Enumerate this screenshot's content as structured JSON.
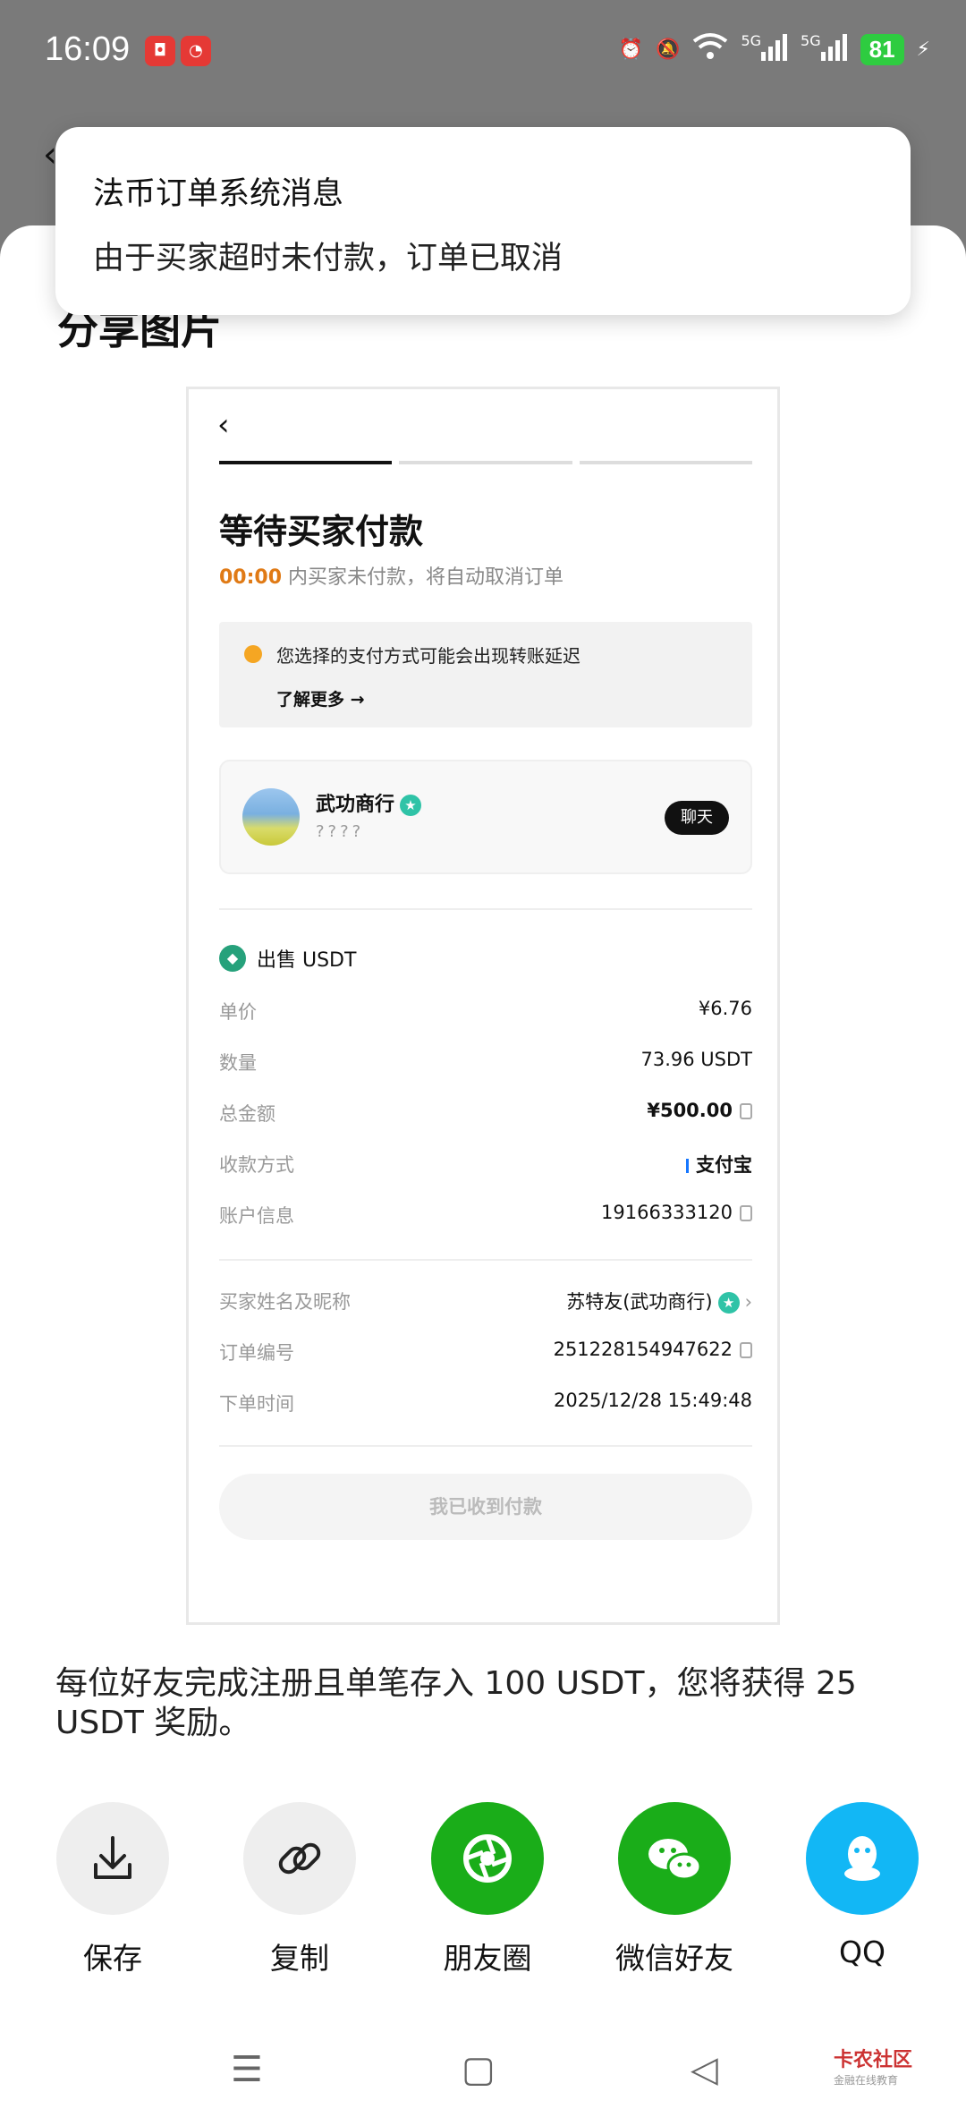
{
  "status_bar": {
    "time": "16:09",
    "battery": "81",
    "network_1": "5G",
    "network_2": "5G"
  },
  "toast": {
    "title": "法币订单系统消息",
    "body": "由于买家超时未付款，订单已取消"
  },
  "sheet": {
    "title": "分享图片"
  },
  "preview": {
    "heading": "等待买家付款",
    "timer": "00:00",
    "timer_suffix": "内买家未付款，将自动取消订单",
    "notice": "您选择的支付方式可能会出现转账延迟",
    "learn_more": "了解更多 →",
    "merchant": {
      "name": "武功商行",
      "nickname": "????",
      "chat": "聊天"
    },
    "sell_label": "出售 USDT",
    "rows": [
      {
        "key": "单价",
        "value": "¥6.76"
      },
      {
        "key": "数量",
        "value": "73.96 USDT"
      },
      {
        "key": "总金额",
        "value": "¥500.00"
      },
      {
        "key": "收款方式",
        "value": "支付宝"
      },
      {
        "key": "账户信息",
        "value": "19166333120"
      }
    ],
    "rows2": [
      {
        "key": "买家姓名及昵称",
        "value": "苏特友(武功商行)"
      },
      {
        "key": "订单编号",
        "value": "251228154947622"
      },
      {
        "key": "下单时间",
        "value": "2025/12/28 15:49:48"
      }
    ],
    "confirm_button": "我已收到付款"
  },
  "referral_text": "每位好友完成注册且单笔存入 100 USDT，您将获得 25 USDT 奖励。",
  "share": [
    {
      "label": "保存",
      "icon": "download-icon"
    },
    {
      "label": "复制",
      "icon": "link-icon"
    },
    {
      "label": "朋友圈",
      "icon": "moments-icon"
    },
    {
      "label": "微信好友",
      "icon": "wechat-icon"
    },
    {
      "label": "QQ",
      "icon": "qq-icon"
    }
  ],
  "watermark": "卡农社区",
  "watermark_sub": "金融在线教育",
  "colors": {
    "timer": "#e07a15",
    "wechat_green": "#1aad19",
    "qq_blue": "#12b7f5",
    "usdt_green": "#26a17b"
  }
}
